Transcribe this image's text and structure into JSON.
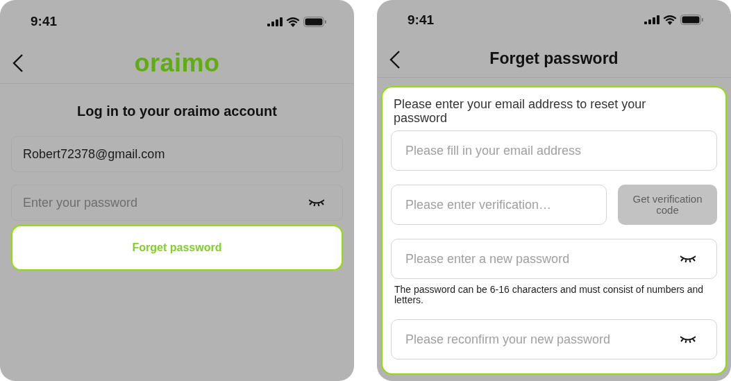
{
  "login_screen": {
    "status_bar": {
      "time": "9:41"
    },
    "logo": "oraimo",
    "heading": "Log in to your oraimo account",
    "fields": [
      {
        "kind": "text",
        "value": "Robert72378@gmail.com"
      },
      {
        "kind": "password",
        "placeholder": "Enter your password"
      }
    ],
    "forget_button": "Forget password"
  },
  "forgot_screen": {
    "status_bar": {
      "time": "9:41"
    },
    "title": "Forget password",
    "intro": "Please enter your email address to reset your password",
    "fields": [
      {
        "kind": "text",
        "placeholder": "Please fill in your email address"
      },
      {
        "kind": "code",
        "placeholder": "Please enter verification…",
        "button": {
          "label": "Get verification code",
          "disabled": true
        }
      },
      {
        "kind": "password",
        "placeholder": "Please enter a new password",
        "hint": "The password can be 6-16 characters and must consist of numbers and letters."
      },
      {
        "kind": "password",
        "placeholder": "Please reconfirm your new password"
      }
    ]
  }
}
